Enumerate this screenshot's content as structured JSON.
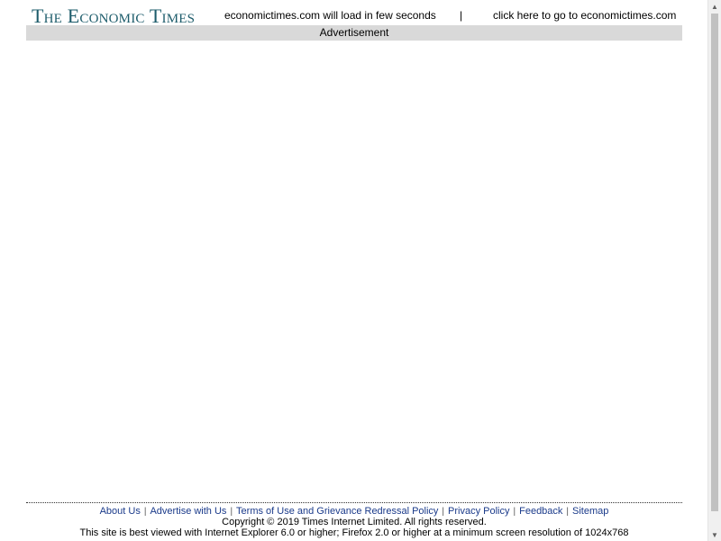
{
  "header": {
    "logo_text": "The Economic Times",
    "loading_message": "economictimes.com will load in few seconds",
    "separator": "|",
    "go_link": "click here to go to economictimes.com"
  },
  "ad": {
    "label": "Advertisement"
  },
  "footer": {
    "links": [
      {
        "label": "About Us"
      },
      {
        "label": "Advertise with Us"
      },
      {
        "label": "Terms of Use and Grievance Redressal Policy"
      },
      {
        "label": "Privacy Policy"
      },
      {
        "label": "Feedback"
      },
      {
        "label": "Sitemap"
      }
    ],
    "pipe": "|",
    "copyright": "Copyright ©   2019  Times Internet Limited. All rights reserved.",
    "best_viewed": "This site is best viewed with Internet Explorer 6.0 or higher; Firefox 2.0 or higher at a minimum screen resolution of 1024x768"
  },
  "icons": {
    "scroll_up": "triangle-up-icon",
    "scroll_down": "triangle-down-icon"
  },
  "colors": {
    "logo": "#1d5c6b",
    "link": "#1a3a8a",
    "ad_bar": "#d9d9d9"
  }
}
